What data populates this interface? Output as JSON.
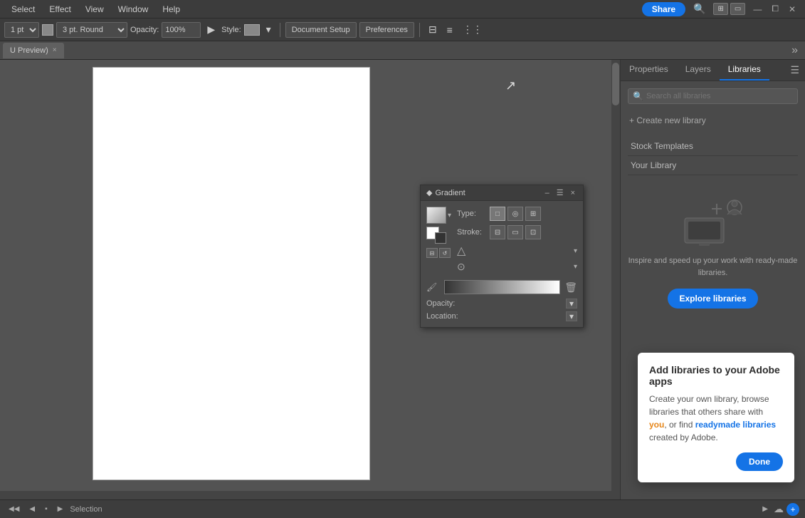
{
  "menu": {
    "items": [
      "Select",
      "Effect",
      "View",
      "Window",
      "Help"
    ]
  },
  "menubar": {
    "share_label": "Share",
    "search_placeholder": "Search all libraries"
  },
  "toolbar": {
    "stroke_size": "1 pt",
    "stroke_label": "3 pt. Round",
    "opacity_label": "Opacity:",
    "opacity_value": "100%",
    "style_label": "Style:",
    "doc_setup_label": "Document Setup",
    "preferences_label": "Preferences"
  },
  "tab": {
    "name": "U Preview)",
    "close": "×"
  },
  "gradient_panel": {
    "title": "Gradient",
    "type_label": "Type:",
    "stroke_label": "Stroke:",
    "opacity_label": "Opacity:",
    "location_label": "Location:",
    "menu_icon": "☰",
    "minimize_icon": "–",
    "close_icon": "×"
  },
  "right_panel": {
    "tabs": [
      "Properties",
      "Layers",
      "Libraries"
    ],
    "active_tab": "Libraries",
    "create_library_label": "+ Create new library",
    "stock_templates_label": "Stock Templates",
    "your_library_label": "Your Library",
    "promo_text": "Inspire and speed up your work with ready-made libraries.",
    "explore_btn_label": "Explore libraries"
  },
  "tooltip": {
    "title": "Add libraries to your Adobe apps",
    "body_part1": "Create your own library, browse libraries that others share with ",
    "highlight_orange": "you",
    "body_part2": ", or find ",
    "highlight_blue": "readymade libraries",
    "body_part3": " created by Adobe.",
    "done_label": "Done"
  },
  "status_bar": {
    "selection_label": "Selection"
  }
}
